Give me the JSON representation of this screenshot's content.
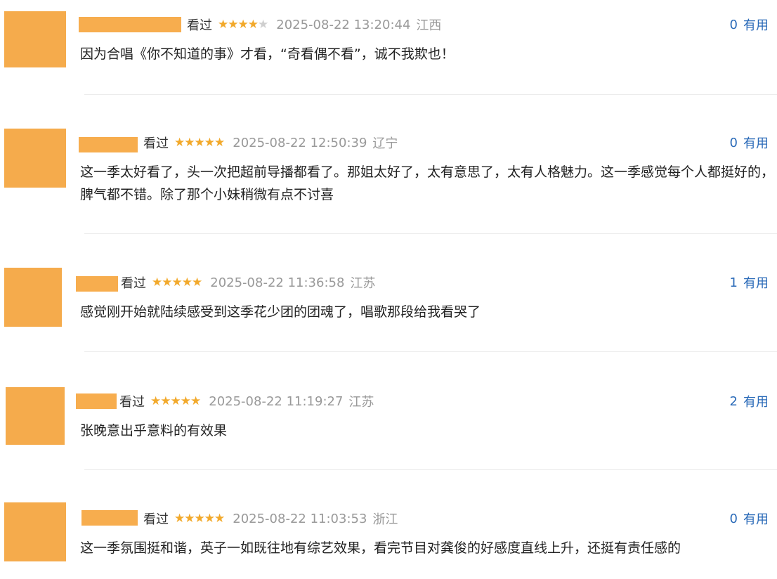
{
  "colors": {
    "avatar": "#f5ab4c",
    "star": "#f2a92b",
    "link": "#2a6ab8",
    "meta": "#999999"
  },
  "star_icon": "star-icon",
  "reviews": [
    {
      "watched": "看过",
      "rating": 4,
      "time": "2025-08-22 13:20:44",
      "region": "江西",
      "votes": "0",
      "useful": "有用",
      "text": "因为合唱《你不知道的事》才看，“奇看偶不看”，诚不我欺也！"
    },
    {
      "watched": "看过",
      "rating": 5,
      "time": "2025-08-22 12:50:39",
      "region": "辽宁",
      "votes": "0",
      "useful": "有用",
      "text": "这一季太好看了，头一次把超前导播都看了。那姐太好了，太有意思了，太有人格魅力。这一季感觉每个人都挺好的，脾气都不错。除了那个小妹稍微有点不讨喜"
    },
    {
      "watched": "看过",
      "rating": 5,
      "time": "2025-08-22 11:36:58",
      "region": "江苏",
      "votes": "1",
      "useful": "有用",
      "text": "感觉刚开始就陆续感受到这季花少团的团魂了，唱歌那段给我看哭了"
    },
    {
      "watched": "看过",
      "rating": 5,
      "time": "2025-08-22 11:19:27",
      "region": "江苏",
      "votes": "2",
      "useful": "有用",
      "text": "张晚意出乎意料的有效果"
    },
    {
      "watched": "看过",
      "rating": 5,
      "time": "2025-08-22 11:03:53",
      "region": "浙江",
      "votes": "0",
      "useful": "有用",
      "text": "这一季氛围挺和谐，英子一如既往地有综艺效果，看完节目对龚俊的好感度直线上升，还挺有责任感的"
    }
  ]
}
